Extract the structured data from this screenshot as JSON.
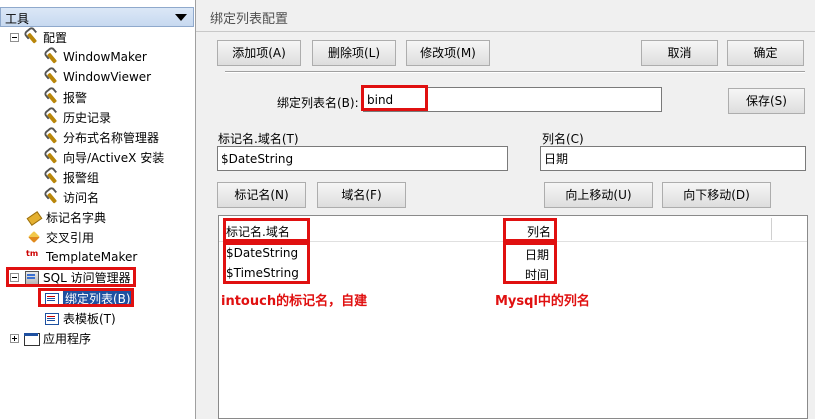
{
  "tree": {
    "header": "工具",
    "nodes": [
      {
        "label": "配置"
      },
      {
        "label": "WindowMaker"
      },
      {
        "label": "WindowViewer"
      },
      {
        "label": "报警"
      },
      {
        "label": "历史记录"
      },
      {
        "label": "分布式名称管理器"
      },
      {
        "label": "向导/ActiveX 安装"
      },
      {
        "label": "报警组"
      },
      {
        "label": "访问名"
      },
      {
        "label": "标记名字典"
      },
      {
        "label": "交叉引用"
      },
      {
        "label": "TemplateMaker"
      },
      {
        "label": "SQL 访问管理器"
      },
      {
        "label": "绑定列表(B)"
      },
      {
        "label": "表模板(T)"
      },
      {
        "label": "应用程序"
      }
    ],
    "icon_tm": "tm"
  },
  "dialog": {
    "title": "绑定列表配置",
    "buttons": {
      "add": "添加项(A)",
      "delete": "删除项(L)",
      "modify": "修改项(M)",
      "cancel": "取消",
      "ok": "确定",
      "save": "保存(S)",
      "tagname": "标记名(N)",
      "domain": "域名(F)",
      "move_up": "向上移动(U)",
      "move_down": "向下移动(D)"
    },
    "bind_list_label": "绑定列表名(B):",
    "bind_list_value": "bind",
    "tag_domain_label": "标记名.域名(T)",
    "tag_domain_value": "$DateString",
    "column_label": "列名(C)",
    "column_value": "日期",
    "grid": {
      "headers": [
        "标记名.域名",
        "列名"
      ],
      "rows": [
        {
          "tag": "$DateString",
          "column": "日期"
        },
        {
          "tag": "$TimeString",
          "column": "时间"
        }
      ]
    },
    "annotations": {
      "left": "intouch的标记名，自建",
      "right": "Mysql中的列名"
    }
  },
  "colors": {
    "highlight": "#e01010",
    "selection": "#1e50a0"
  }
}
